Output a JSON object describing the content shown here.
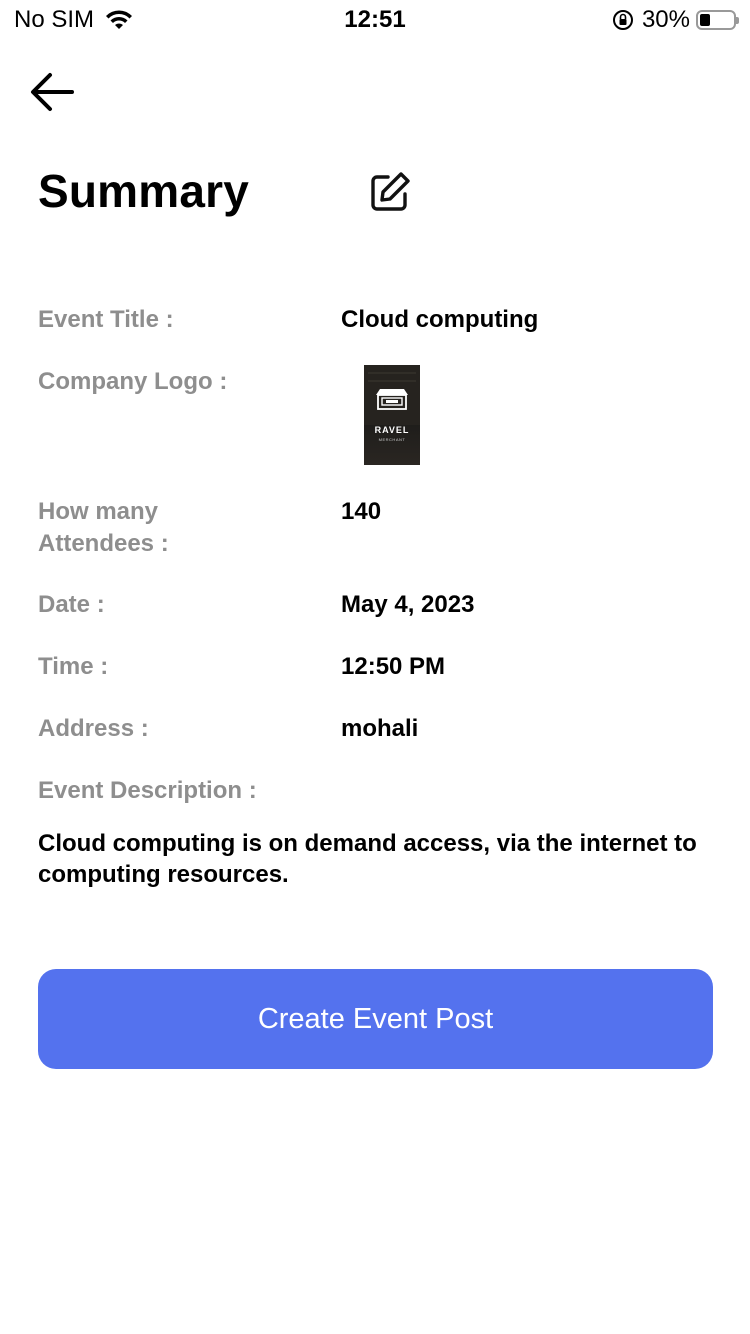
{
  "status_bar": {
    "carrier": "No SIM",
    "time": "12:51",
    "battery_percent_text": "30%",
    "battery_level": 0.3
  },
  "header": {
    "title": "Summary"
  },
  "details": [
    {
      "label": "Event Title :",
      "value": "Cloud computing"
    },
    {
      "label": "Company Logo :",
      "value": null
    },
    {
      "label_line1": "How many",
      "label_line2": "Attendees :",
      "value": "140"
    },
    {
      "label": "Date :",
      "value": "May 4, 2023"
    },
    {
      "label": "Time :",
      "value": "12:50 PM"
    },
    {
      "label": "Address :",
      "value": "mohali"
    },
    {
      "label": "Event Description :"
    }
  ],
  "logo": {
    "text": "RAVEL",
    "subtext": "MERCHANT"
  },
  "description": "Cloud computing is on demand access, via the internet to computing resources.",
  "cta": {
    "label": "Create Event Post",
    "color": "#5472ee"
  },
  "icons": [
    "back-arrow-icon",
    "edit-icon",
    "wifi-icon",
    "orientation-lock-icon",
    "battery-icon"
  ]
}
